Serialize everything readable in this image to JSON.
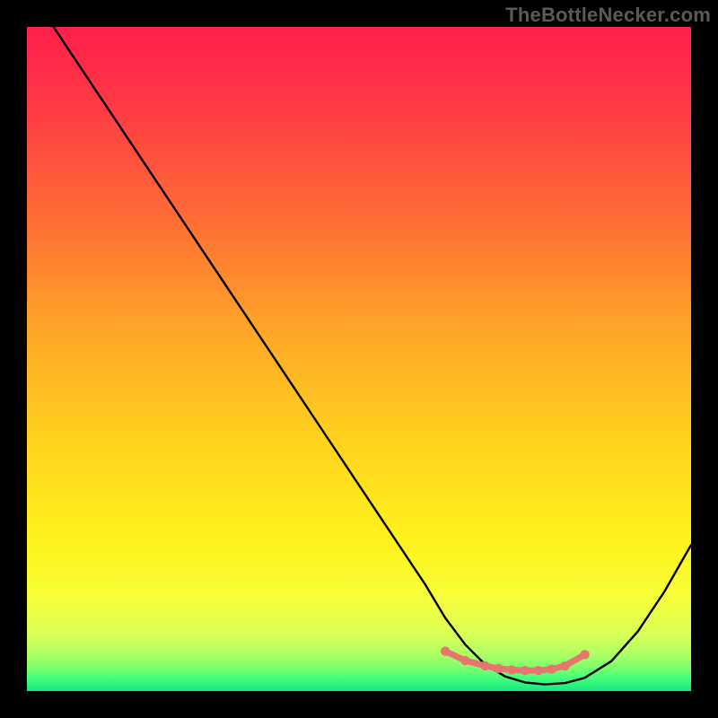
{
  "watermark": "TheBottleNecker.com",
  "colors": {
    "curve": "#000000",
    "marker": "#e9766e",
    "marker_stroke": "#e9766e"
  },
  "chart_data": {
    "type": "line",
    "title": "",
    "xlabel": "",
    "ylabel": "",
    "xlim": [
      0,
      100
    ],
    "ylim": [
      0,
      100
    ],
    "series": [
      {
        "name": "bottleneck_curve",
        "x": [
          4,
          8,
          12,
          16,
          20,
          24,
          28,
          32,
          36,
          40,
          44,
          48,
          52,
          56,
          60,
          63,
          66,
          69,
          72,
          75,
          78,
          81,
          84,
          88,
          92,
          96,
          100
        ],
        "y": [
          100,
          94,
          88,
          82,
          76,
          70,
          64,
          58,
          52,
          46,
          40,
          34,
          28,
          22,
          16,
          11,
          7,
          4,
          2.2,
          1.3,
          1.0,
          1.2,
          2.0,
          4.5,
          9,
          15,
          22
        ]
      }
    ],
    "markers": {
      "name": "optimal_range",
      "x": [
        63,
        66,
        69,
        71,
        73,
        75,
        77,
        79,
        81,
        84
      ],
      "y": [
        6,
        4.6,
        3.8,
        3.4,
        3.2,
        3.1,
        3.1,
        3.3,
        3.8,
        5.5
      ]
    }
  }
}
